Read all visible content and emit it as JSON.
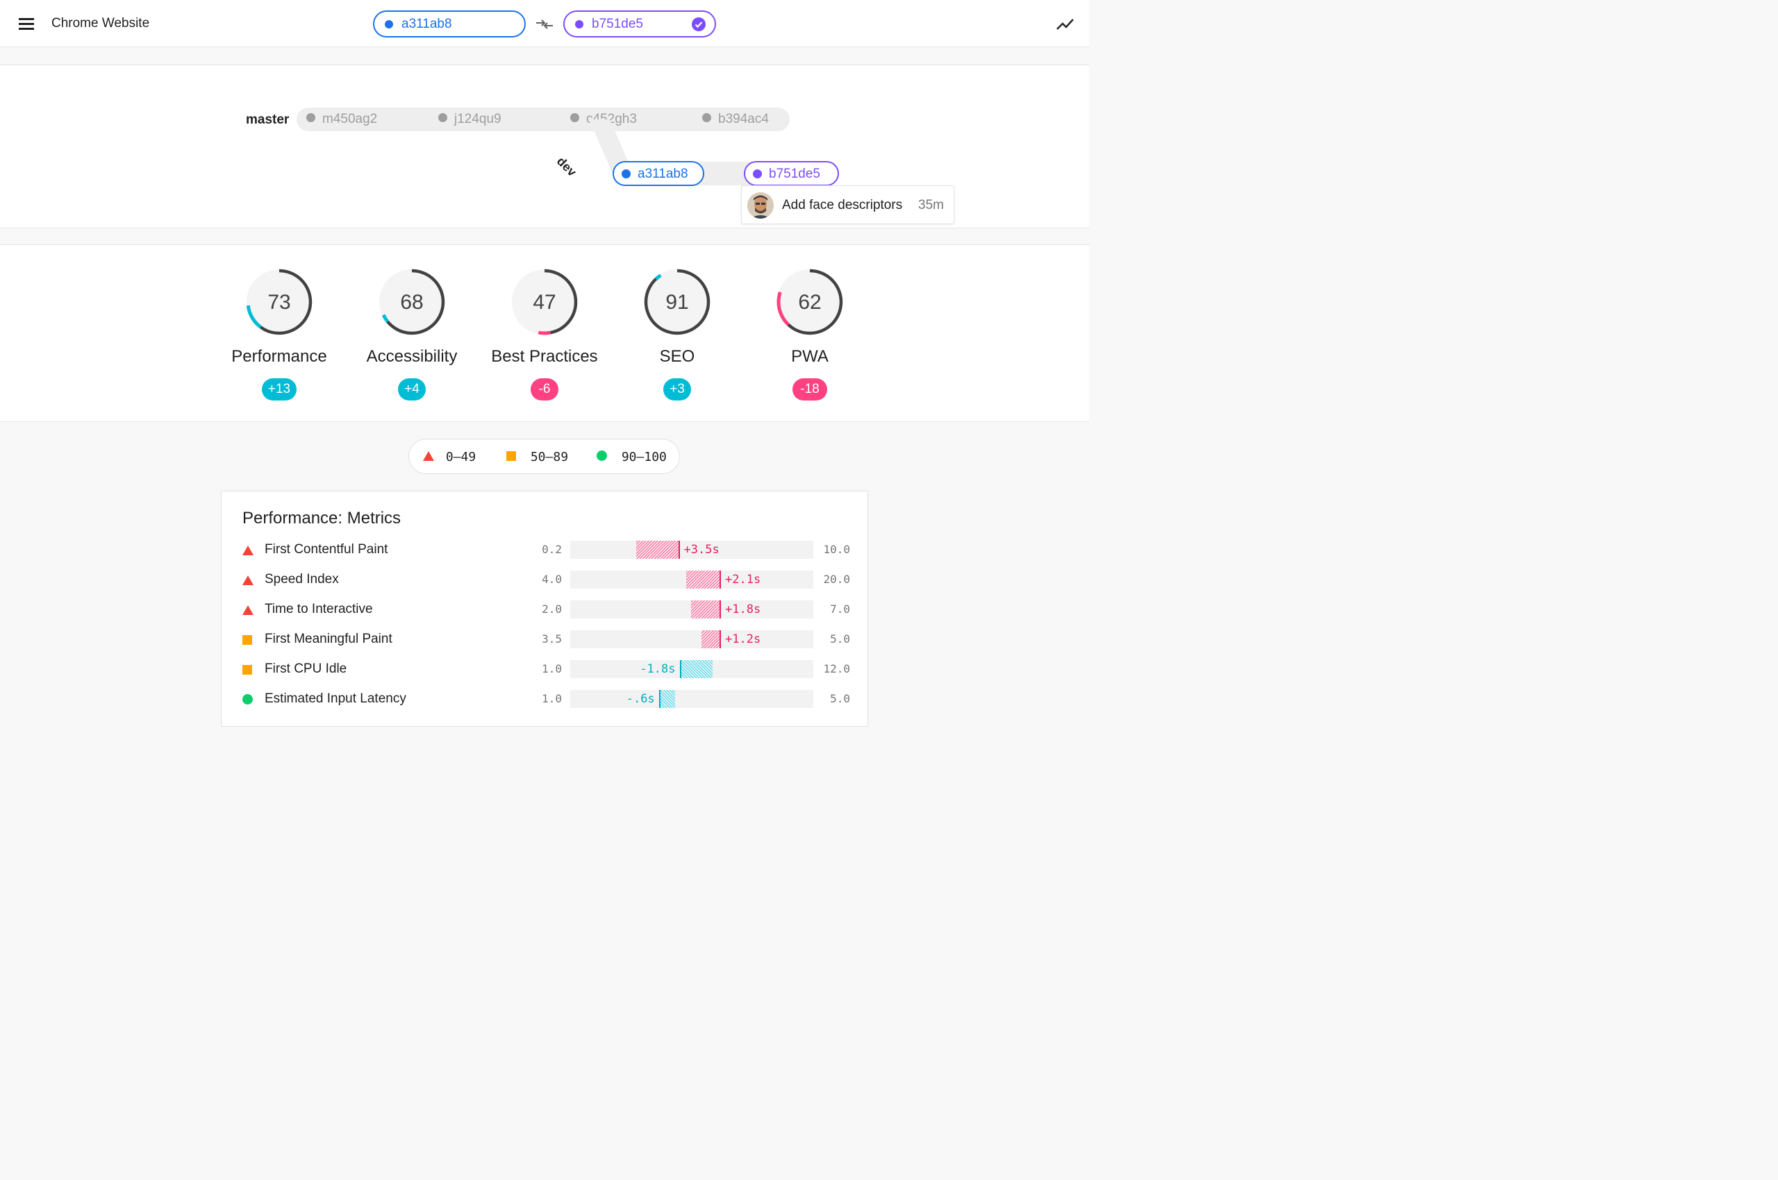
{
  "header": {
    "title": "Chrome Website",
    "base_build": "a311ab8",
    "compare_build": "b751de5",
    "menu_icon": "menu-icon",
    "swap_icon": "compare-arrows-icon",
    "trend_icon": "trending-icon"
  },
  "graph": {
    "master_label": "master",
    "dev_label": "dev",
    "master_commits": [
      "m450ag2",
      "j124qu9",
      "c452gh3",
      "b394ac4"
    ],
    "dev_commits": [
      "a311ab8",
      "b751de5"
    ],
    "tooltip": {
      "message": "Add face descriptors",
      "time": "35m"
    }
  },
  "scores": [
    {
      "category": "Performance",
      "score": "73",
      "delta": "+13",
      "value": 73,
      "base": 60,
      "trend": "up"
    },
    {
      "category": "Accessibility",
      "score": "68",
      "delta": "+4",
      "value": 68,
      "base": 64,
      "trend": "up"
    },
    {
      "category": "Best Practices",
      "score": "47",
      "delta": "-6",
      "value": 47,
      "base": 53,
      "trend": "down"
    },
    {
      "category": "SEO",
      "score": "91",
      "delta": "+3",
      "value": 91,
      "base": 88,
      "trend": "up"
    },
    {
      "category": "PWA",
      "score": "62",
      "delta": "-18",
      "value": 62,
      "base": 80,
      "trend": "down"
    }
  ],
  "legend": {
    "poor": "0–49",
    "average": "50–89",
    "good": "90–100"
  },
  "metrics": {
    "title": "Performance: Metrics",
    "rows": [
      {
        "name": "First Contentful Paint",
        "status": "poor",
        "low": "0.2",
        "high": "10.0",
        "delta": "+3.5s",
        "from": 0.27,
        "to": 0.45,
        "direction": "worse"
      },
      {
        "name": "Speed Index",
        "status": "poor",
        "low": "4.0",
        "high": "20.0",
        "delta": "+2.1s",
        "from": 0.477,
        "to": 0.62,
        "direction": "worse"
      },
      {
        "name": "Time to Interactive",
        "status": "poor",
        "low": "2.0",
        "high": "7.0",
        "delta": "+1.8s",
        "from": 0.497,
        "to": 0.62,
        "direction": "worse"
      },
      {
        "name": "First Meaningful Paint",
        "status": "average",
        "low": "3.5",
        "high": "5.0",
        "delta": "+1.2s",
        "from": 0.54,
        "to": 0.62,
        "direction": "worse"
      },
      {
        "name": "First CPU Idle",
        "status": "average",
        "low": "1.0",
        "high": "12.0",
        "delta": "-1.8s",
        "from": 0.45,
        "to": 0.587,
        "direction": "better"
      },
      {
        "name": "Estimated Input Latency",
        "status": "good",
        "low": "1.0",
        "high": "5.0",
        "delta": "-.6s",
        "from": 0.365,
        "to": 0.43,
        "direction": "better"
      }
    ]
  },
  "colors": {
    "base": "#1a73e8",
    "compare": "#7c4dff",
    "improved": "#00bcd4",
    "regressed": "#ff4081",
    "poor": "#f44336",
    "average": "#ffa400",
    "good": "#0cce6b"
  }
}
